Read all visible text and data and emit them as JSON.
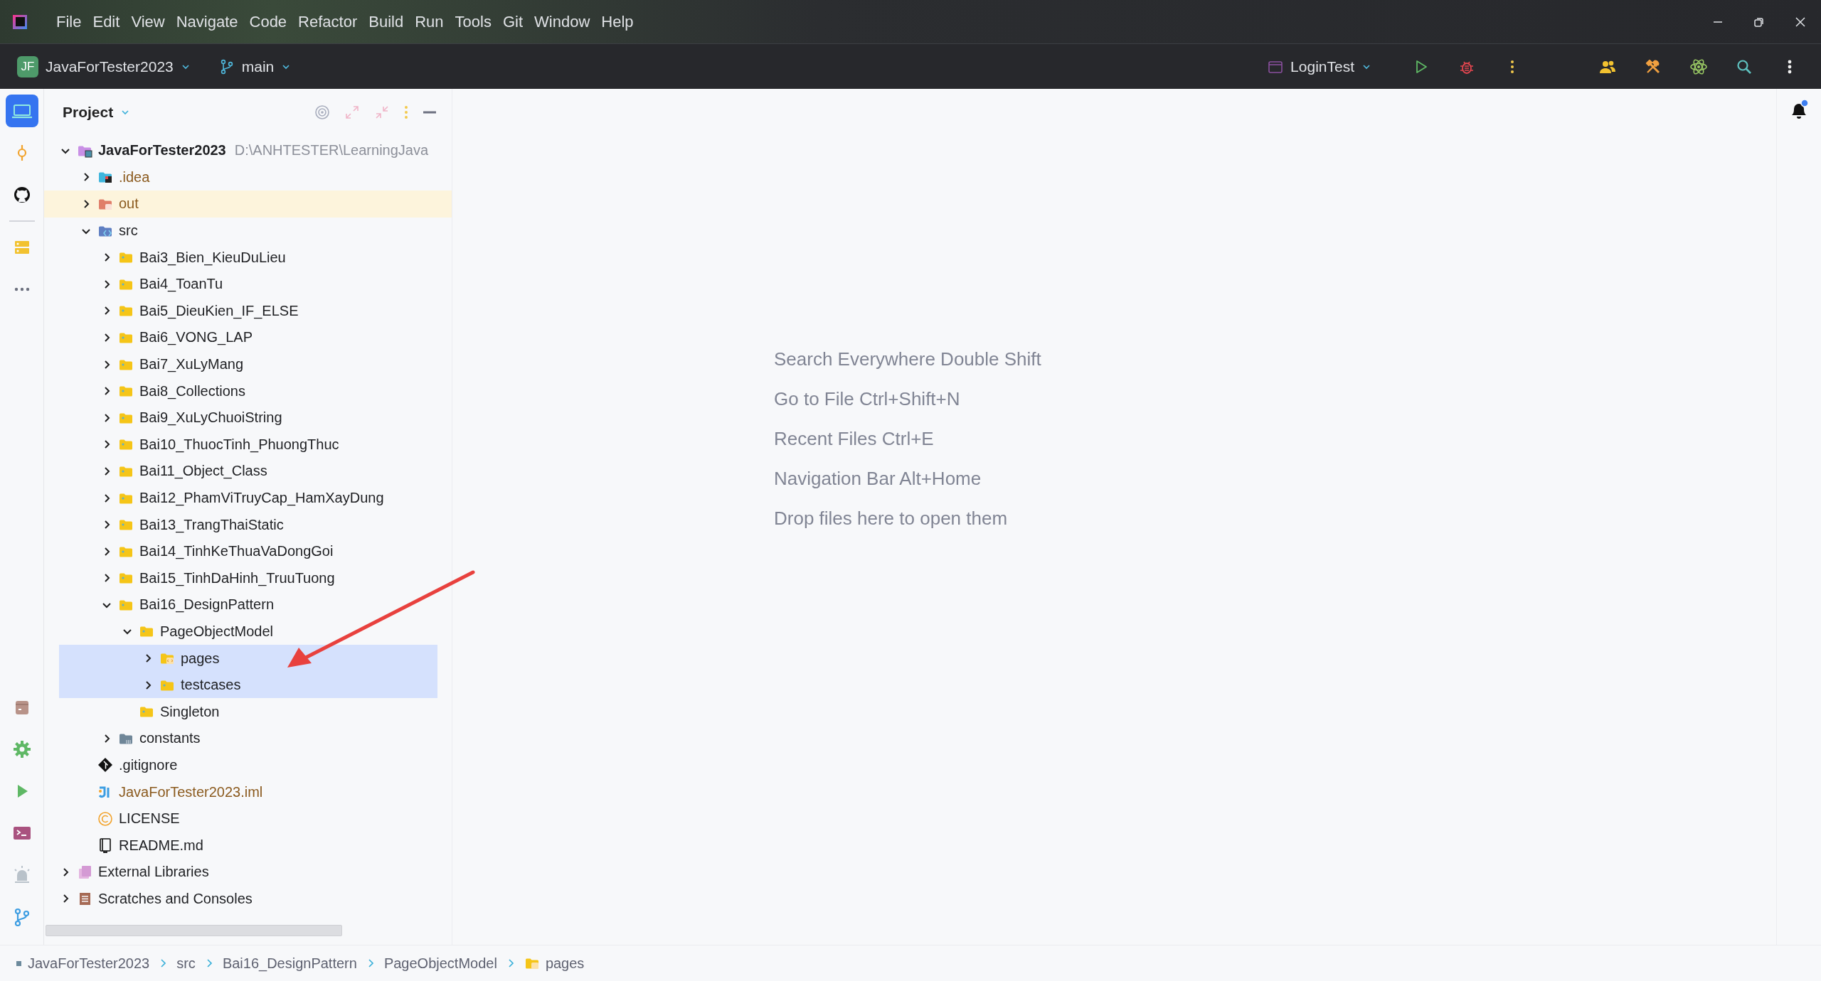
{
  "menu_bar": {
    "items": [
      "File",
      "Edit",
      "View",
      "Navigate",
      "Code",
      "Refactor",
      "Build",
      "Run",
      "Tools",
      "Git",
      "Window",
      "Help"
    ]
  },
  "toolbar": {
    "project_badge": "JF",
    "project": "JavaForTester2023",
    "branch": "main",
    "run_config": "LoginTest"
  },
  "tool_stripe": {
    "top": [
      {
        "kind": "project",
        "selected": true
      },
      {
        "kind": "commit",
        "selected": false
      },
      {
        "kind": "github",
        "selected": false
      },
      {
        "kind": "structure",
        "selected": false
      },
      {
        "kind": "more",
        "selected": false
      }
    ],
    "bottom": [
      {
        "kind": "services",
        "selected": false
      },
      {
        "kind": "settings",
        "selected": false
      },
      {
        "kind": "run",
        "selected": false
      },
      {
        "kind": "terminal",
        "selected": false
      },
      {
        "kind": "problems",
        "selected": false
      },
      {
        "kind": "git",
        "selected": false
      }
    ]
  },
  "project_panel": {
    "title": "Project",
    "tree": [
      {
        "kind": "module",
        "label": "JavaForTester2023",
        "path": "D:\\ANHTESTER\\LearningJava",
        "expanded": true,
        "selected": false,
        "children": [
          {
            "kind": "idea",
            "label": ".idea",
            "expanded": false,
            "selected": false
          },
          {
            "kind": "excluded",
            "label": "out",
            "expanded": false,
            "selected": false
          },
          {
            "kind": "source",
            "label": "src",
            "expanded": true,
            "selected": false,
            "children": [
              {
                "kind": "package",
                "label": "Bai3_Bien_KieuDuLieu",
                "expanded": false,
                "selected": false
              },
              {
                "kind": "package",
                "label": "Bai4_ToanTu",
                "expanded": false,
                "selected": false
              },
              {
                "kind": "package",
                "label": "Bai5_DieuKien_IF_ELSE",
                "expanded": false,
                "selected": false
              },
              {
                "kind": "package",
                "label": "Bai6_VONG_LAP",
                "expanded": false,
                "selected": false
              },
              {
                "kind": "package",
                "label": "Bai7_XuLyMang",
                "expanded": false,
                "selected": false
              },
              {
                "kind": "package",
                "label": "Bai8_Collections",
                "expanded": false,
                "selected": false
              },
              {
                "kind": "package",
                "label": "Bai9_XuLyChuoiString",
                "expanded": false,
                "selected": false
              },
              {
                "kind": "package",
                "label": "Bai10_ThuocTinh_PhuongThuc",
                "expanded": false,
                "selected": false
              },
              {
                "kind": "package",
                "label": "Bai11_Object_Class",
                "expanded": false,
                "selected": false
              },
              {
                "kind": "package",
                "label": "Bai12_PhamViTruyCap_HamXayDung",
                "expanded": false,
                "selected": false
              },
              {
                "kind": "package",
                "label": "Bai13_TrangThaiStatic",
                "expanded": false,
                "selected": false
              },
              {
                "kind": "package",
                "label": "Bai14_TinhKeThuaVaDongGoi",
                "expanded": false,
                "selected": false
              },
              {
                "kind": "package",
                "label": "Bai15_TinhDaHinh_TruuTuong",
                "expanded": false,
                "selected": false
              },
              {
                "kind": "package",
                "label": "Bai16_DesignPattern",
                "expanded": true,
                "selected": false,
                "children": [
                  {
                    "kind": "package",
                    "label": "PageObjectModel",
                    "expanded": true,
                    "selected": false,
                    "children": [
                      {
                        "kind": "code-package",
                        "label": "pages",
                        "expanded": false,
                        "selected": true
                      },
                      {
                        "kind": "package",
                        "label": "testcases",
                        "expanded": false,
                        "selected": true
                      }
                    ]
                  },
                  {
                    "kind": "package",
                    "label": "Singleton",
                    "selected": false
                  }
                ]
              },
              {
                "kind": "plain-folder",
                "label": "constants",
                "expanded": false,
                "selected": false
              }
            ]
          },
          {
            "kind": "gitignore",
            "label": ".gitignore",
            "selected": false
          },
          {
            "kind": "iml",
            "label": "JavaForTester2023.iml",
            "selected": false
          },
          {
            "kind": "license",
            "label": "LICENSE",
            "selected": false
          },
          {
            "kind": "readme",
            "label": "README.md",
            "selected": false
          }
        ]
      },
      {
        "kind": "libraries",
        "label": "External Libraries",
        "expanded": false,
        "selected": false
      },
      {
        "kind": "scratches",
        "label": "Scratches and Consoles",
        "expanded": false,
        "selected": false
      }
    ]
  },
  "welcome_hints": [
    "Search Everywhere Double Shift",
    "Go to File Ctrl+Shift+N",
    "Recent Files Ctrl+E",
    "Navigation Bar Alt+Home",
    "Drop files here to open them"
  ],
  "notifications": {
    "unread": true
  },
  "breadcrumbs": [
    {
      "kind": "module",
      "label": "JavaForTester2023"
    },
    {
      "kind": "plain",
      "label": "src"
    },
    {
      "kind": "plain",
      "label": "Bai16_DesignPattern"
    },
    {
      "kind": "plain",
      "label": "PageObjectModel"
    },
    {
      "kind": "folder",
      "label": "pages"
    }
  ]
}
